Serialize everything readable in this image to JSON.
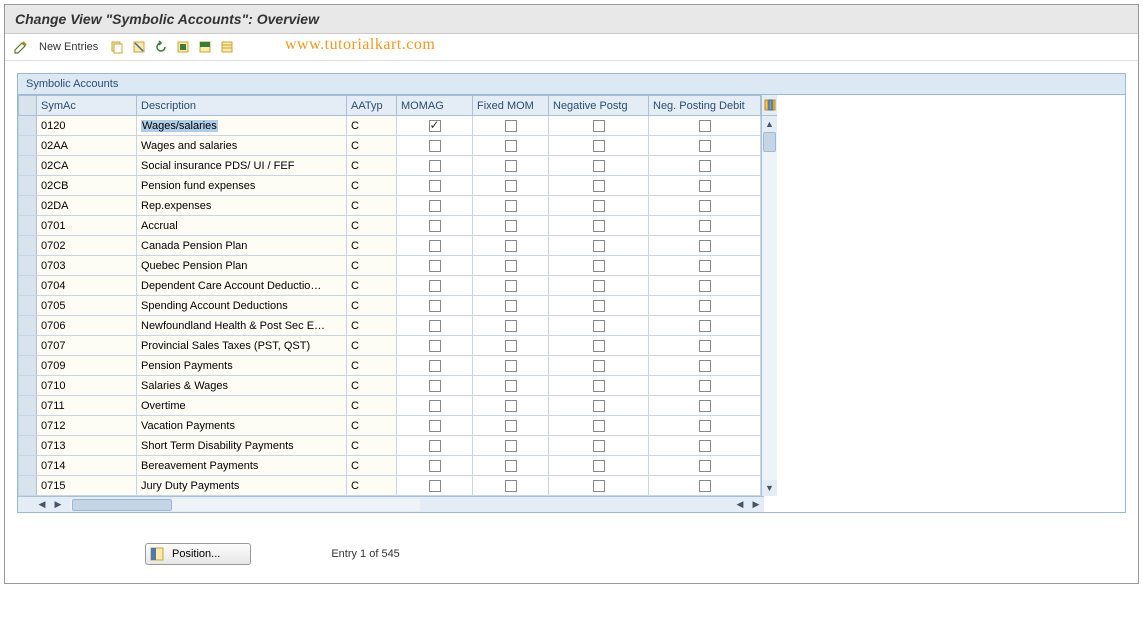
{
  "title": "Change View \"Symbolic Accounts\": Overview",
  "toolbar": {
    "new_entries": "New Entries"
  },
  "watermark": "www.tutorialkart.com",
  "grid": {
    "panel_title": "Symbolic Accounts",
    "headers": {
      "symac": "SymAc",
      "desc": "Description",
      "aatyp": "AATyp",
      "momag": "MOMAG",
      "fixed_mom": "Fixed MOM",
      "neg_postg": "Negative Postg",
      "neg_debit": "Neg. Posting Debit"
    },
    "rows": [
      {
        "symac": "0120",
        "desc": "Wages/salaries",
        "desc_selected": true,
        "aatyp": "C",
        "momag": true,
        "fixed": false,
        "negp": false,
        "negd": false
      },
      {
        "symac": "02AA",
        "desc": "Wages and salaries",
        "aatyp": "C",
        "momag": false,
        "fixed": false,
        "negp": false,
        "negd": false
      },
      {
        "symac": "02CA",
        "desc": "Social insurance PDS/ UI / FEF",
        "aatyp": "C",
        "momag": false,
        "fixed": false,
        "negp": false,
        "negd": false
      },
      {
        "symac": "02CB",
        "desc": "Pension fund expenses",
        "aatyp": "C",
        "momag": false,
        "fixed": false,
        "negp": false,
        "negd": false
      },
      {
        "symac": "02DA",
        "desc": "Rep.expenses",
        "aatyp": "C",
        "momag": false,
        "fixed": false,
        "negp": false,
        "negd": false
      },
      {
        "symac": "0701",
        "desc": "Accrual",
        "aatyp": "C",
        "momag": false,
        "fixed": false,
        "negp": false,
        "negd": false
      },
      {
        "symac": "0702",
        "desc": "Canada Pension Plan",
        "aatyp": "C",
        "momag": false,
        "fixed": false,
        "negp": false,
        "negd": false
      },
      {
        "symac": "0703",
        "desc": "Quebec Pension Plan",
        "aatyp": "C",
        "momag": false,
        "fixed": false,
        "negp": false,
        "negd": false
      },
      {
        "symac": "0704",
        "desc": "Dependent Care Account Deductio…",
        "aatyp": "C",
        "momag": false,
        "fixed": false,
        "negp": false,
        "negd": false
      },
      {
        "symac": "0705",
        "desc": "Spending Account Deductions",
        "aatyp": "C",
        "momag": false,
        "fixed": false,
        "negp": false,
        "negd": false
      },
      {
        "symac": "0706",
        "desc": "Newfoundland Health & Post Sec E…",
        "aatyp": "C",
        "momag": false,
        "fixed": false,
        "negp": false,
        "negd": false
      },
      {
        "symac": "0707",
        "desc": "Provincial Sales Taxes (PST, QST)",
        "aatyp": "C",
        "momag": false,
        "fixed": false,
        "negp": false,
        "negd": false
      },
      {
        "symac": "0709",
        "desc": "Pension Payments",
        "aatyp": "C",
        "momag": false,
        "fixed": false,
        "negp": false,
        "negd": false
      },
      {
        "symac": "0710",
        "desc": "Salaries & Wages",
        "aatyp": "C",
        "momag": false,
        "fixed": false,
        "negp": false,
        "negd": false
      },
      {
        "symac": "0711",
        "desc": "Overtime",
        "aatyp": "C",
        "momag": false,
        "fixed": false,
        "negp": false,
        "negd": false
      },
      {
        "symac": "0712",
        "desc": "Vacation Payments",
        "aatyp": "C",
        "momag": false,
        "fixed": false,
        "negp": false,
        "negd": false
      },
      {
        "symac": "0713",
        "desc": "Short Term Disability Payments",
        "aatyp": "C",
        "momag": false,
        "fixed": false,
        "negp": false,
        "negd": false
      },
      {
        "symac": "0714",
        "desc": "Bereavement Payments",
        "aatyp": "C",
        "momag": false,
        "fixed": false,
        "negp": false,
        "negd": false
      },
      {
        "symac": "0715",
        "desc": "Jury Duty Payments",
        "aatyp": "C",
        "momag": false,
        "fixed": false,
        "negp": false,
        "negd": false
      }
    ]
  },
  "footer": {
    "position_label": "Position...",
    "entry_text": "Entry 1 of 545"
  }
}
